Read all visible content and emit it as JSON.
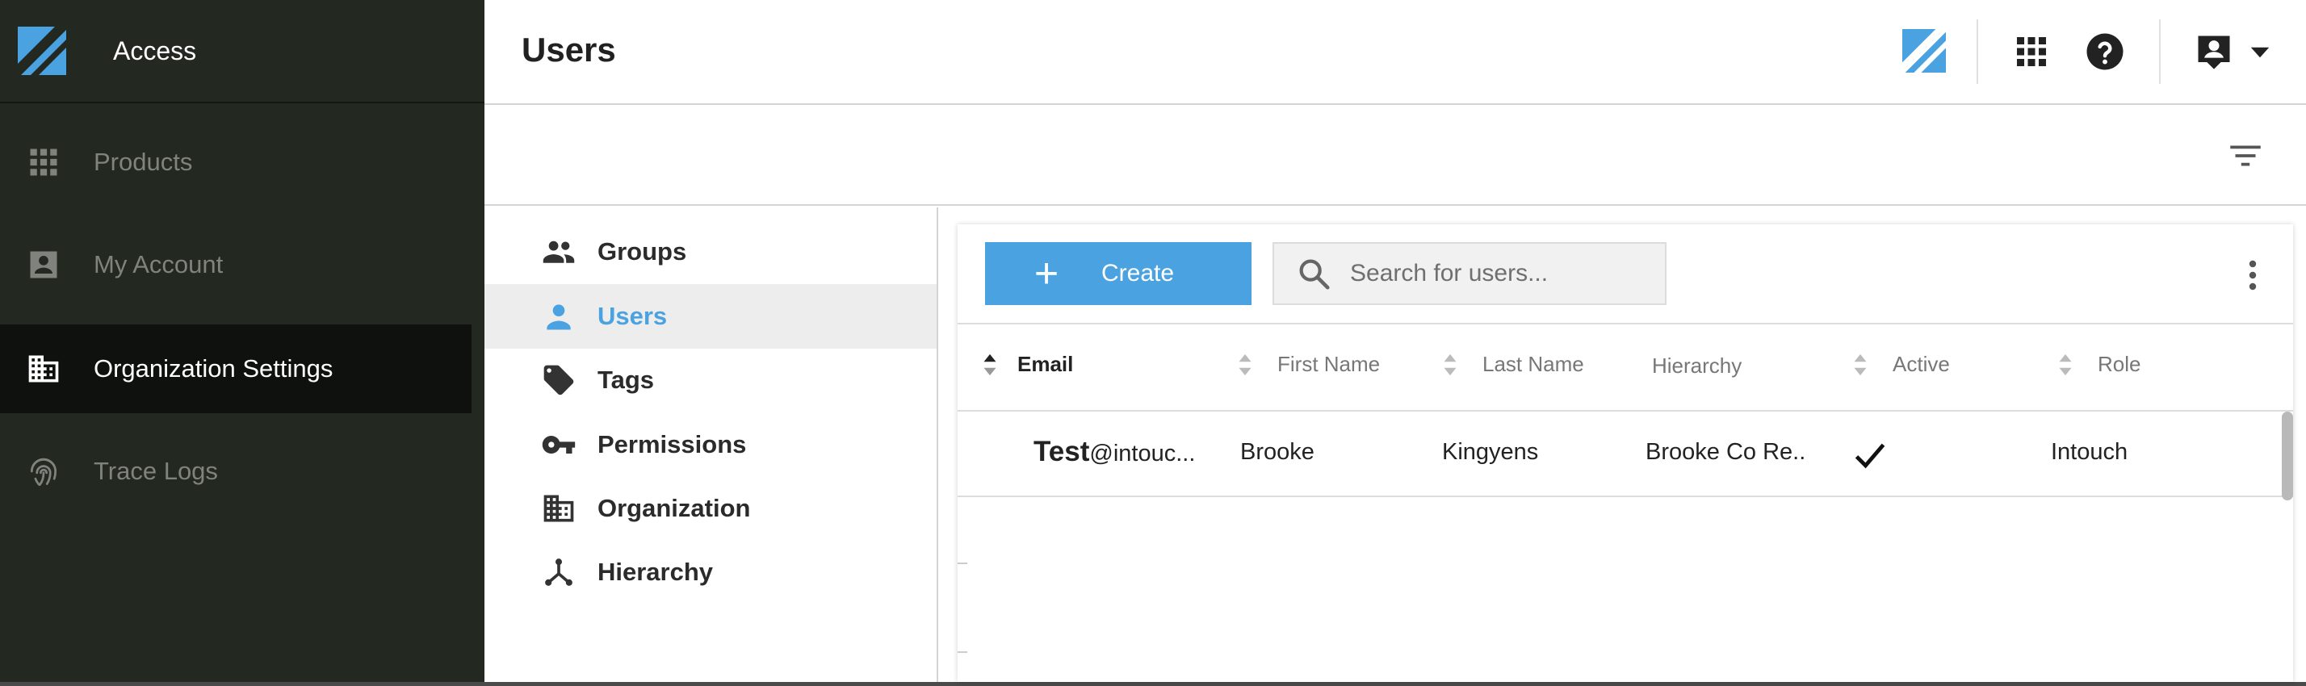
{
  "app": {
    "title": "Access"
  },
  "nav": {
    "items": [
      {
        "label": "Products",
        "icon": "apps-grid-icon"
      },
      {
        "label": "My Account",
        "icon": "account-box-icon"
      },
      {
        "label": "Organization Settings",
        "icon": "building-icon",
        "active": true
      },
      {
        "label": "Trace Logs",
        "icon": "fingerprint-icon"
      }
    ]
  },
  "header": {
    "title": "Users"
  },
  "subnav": {
    "items": [
      {
        "label": "Groups",
        "icon": "groups-icon"
      },
      {
        "label": "Users",
        "icon": "person-icon",
        "active": true
      },
      {
        "label": "Tags",
        "icon": "tag-icon"
      },
      {
        "label": "Permissions",
        "icon": "key-icon"
      },
      {
        "label": "Organization",
        "icon": "building-icon"
      },
      {
        "label": "Hierarchy",
        "icon": "hierarchy-icon"
      }
    ]
  },
  "toolbar": {
    "create_label": "Create",
    "search_placeholder": "Search for users..."
  },
  "table": {
    "columns": [
      "Email",
      "First Name",
      "Last Name",
      "Hierarchy",
      "Active",
      "Role"
    ],
    "rows": [
      {
        "email_bold": "Test",
        "email_rest": "@intouc...",
        "first_name": "Brooke",
        "last_name": "Kingyens",
        "hierarchy": "Brooke Co Re...",
        "active": true,
        "role": "Intouch"
      }
    ]
  },
  "colors": {
    "accent": "#4aa3e0",
    "nav_bg": "#232820",
    "nav_active_bg": "#0f110f"
  }
}
